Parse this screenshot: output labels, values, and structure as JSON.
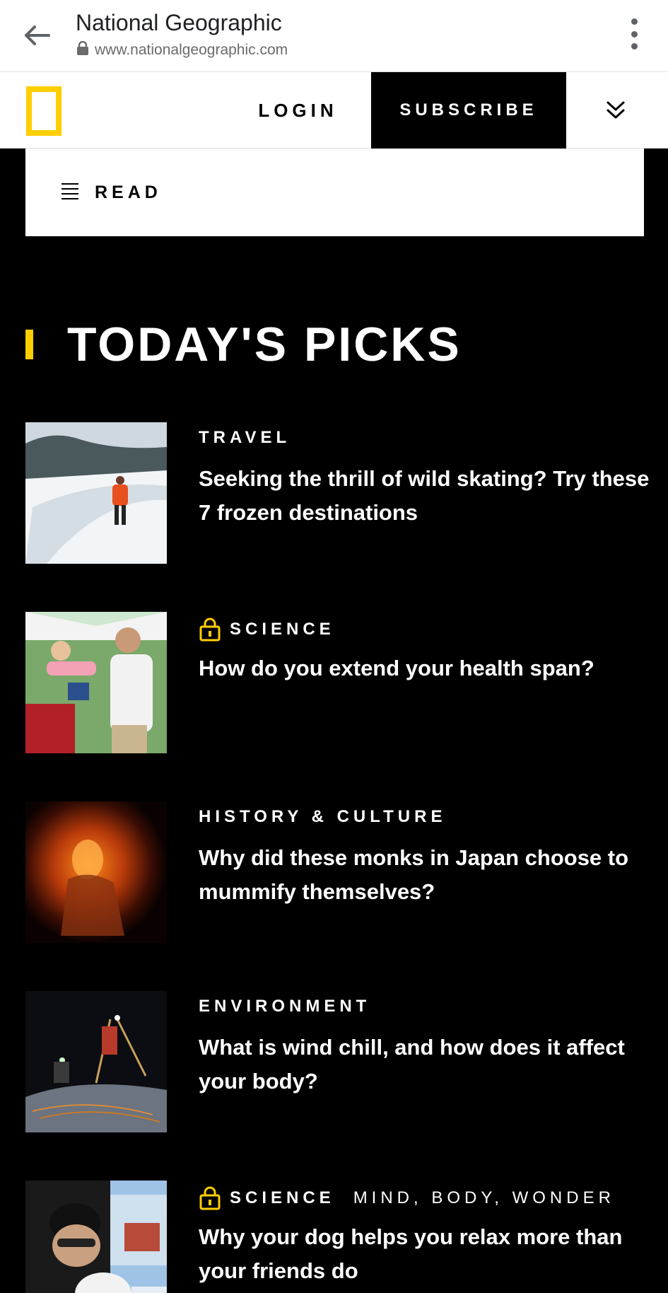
{
  "browser": {
    "title": "National Geographic",
    "url": "www.nationalgeographic.com",
    "icons": {
      "back": "arrow-left-icon",
      "secure": "lock-icon",
      "menu": "kebab-menu-icon"
    }
  },
  "header": {
    "login_label": "LOGIN",
    "subscribe_label": "SUBSCRIBE",
    "logo": "natgeo-yellow-border-logo",
    "expand_icon": "double-chevron-down-icon",
    "accent_color": "#ffce00"
  },
  "read_bar": {
    "label": "READ",
    "icon": "hamburger-icon"
  },
  "section": {
    "title": "TODAY'S PICKS"
  },
  "articles": [
    {
      "category": "TRAVEL",
      "locked": false,
      "subcategory": "",
      "headline": "Seeking the thrill of wild skating? Try these 7 frozen destinations"
    },
    {
      "category": "SCIENCE",
      "locked": true,
      "subcategory": "",
      "headline": "How do you extend your health span?"
    },
    {
      "category": "HISTORY & CULTURE",
      "locked": false,
      "subcategory": "",
      "headline": "Why did these monks in Japan choose to mummify themselves?"
    },
    {
      "category": "ENVIRONMENT",
      "locked": false,
      "subcategory": "",
      "headline": "What is wind chill, and how does it affect your body?"
    },
    {
      "category": "SCIENCE",
      "locked": true,
      "subcategory": "MIND, BODY, WONDER",
      "headline": "Why your dog helps you relax more than your friends do"
    }
  ]
}
